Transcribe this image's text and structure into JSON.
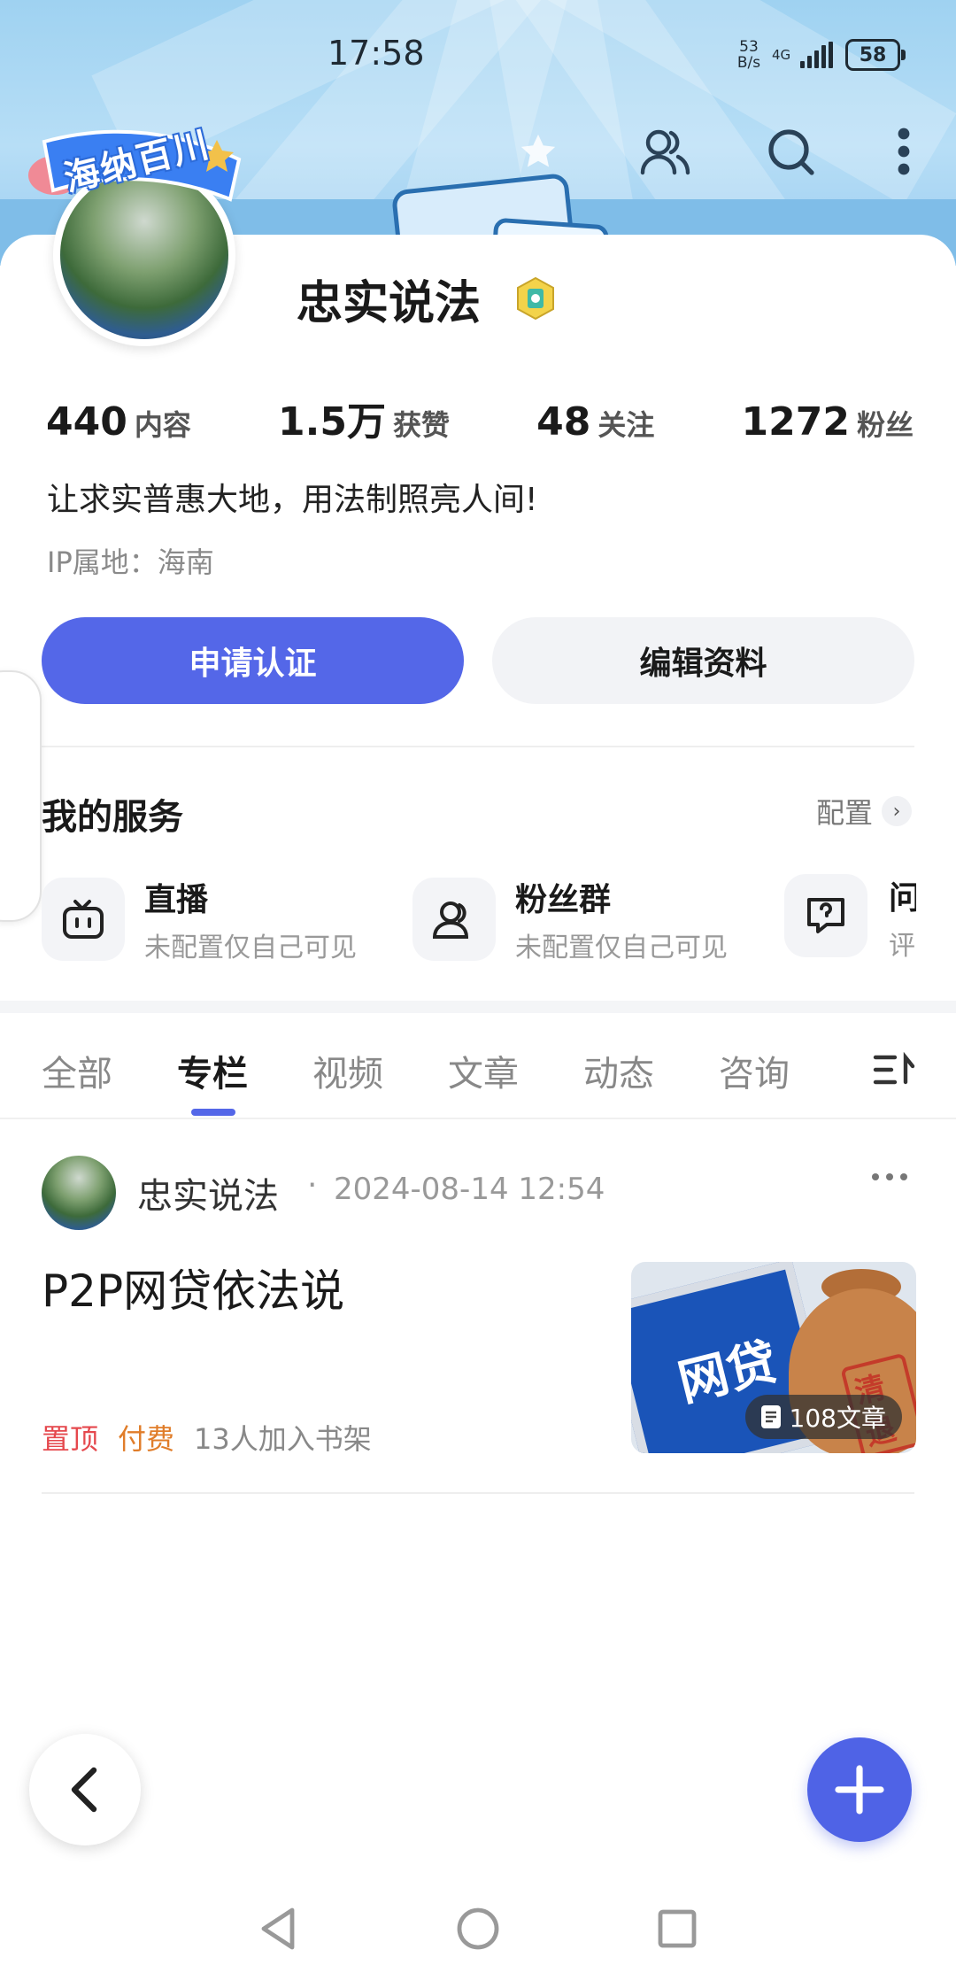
{
  "status_bar": {
    "time": "17:58",
    "net_speed_top": "53",
    "net_speed_bottom": "B/s",
    "network": "4G",
    "battery": "58"
  },
  "header": {
    "icons": [
      "star-icon",
      "friends-icon",
      "search-icon",
      "more-vertical-icon"
    ]
  },
  "profile": {
    "badge_text": "海纳百川",
    "name": "忠实说法",
    "stats": [
      {
        "num": "440",
        "label": "内容"
      },
      {
        "num": "1.5万",
        "label": "获赞"
      },
      {
        "num": "48",
        "label": "关注"
      },
      {
        "num": "1272",
        "label": "粉丝"
      }
    ],
    "bio": "让求实普惠大地，用法制照亮人间!",
    "ip": "IP属地：海南",
    "btn_verify": "申请认证",
    "btn_edit": "编辑资料"
  },
  "services": {
    "title": "我的服务",
    "config": "配置",
    "items": [
      {
        "name": "直播",
        "sub": "未配置仅自己可见",
        "icon": "tv-icon"
      },
      {
        "name": "粉丝群",
        "sub": "未配置仅自己可见",
        "icon": "group-icon"
      },
      {
        "name": "问",
        "sub": "评",
        "icon": "qa-icon"
      }
    ]
  },
  "tabs": [
    "全部",
    "专栏",
    "视频",
    "文章",
    "动态",
    "咨询"
  ],
  "active_tab": "专栏",
  "post": {
    "author": "忠实说法",
    "dot": "·",
    "date": "2024-08-14 12:54",
    "title": "P2P网贷依法说",
    "tag_pin": "置顶",
    "tag_paid": "付费",
    "shelf": "13人加入书架",
    "thumb_monitor_text": "网贷",
    "thumb_stamp": "清退",
    "thumb_count": "108文章"
  },
  "colors": {
    "accent": "#5467e8",
    "pin": "#e5484d",
    "paid": "#e07d2a"
  }
}
